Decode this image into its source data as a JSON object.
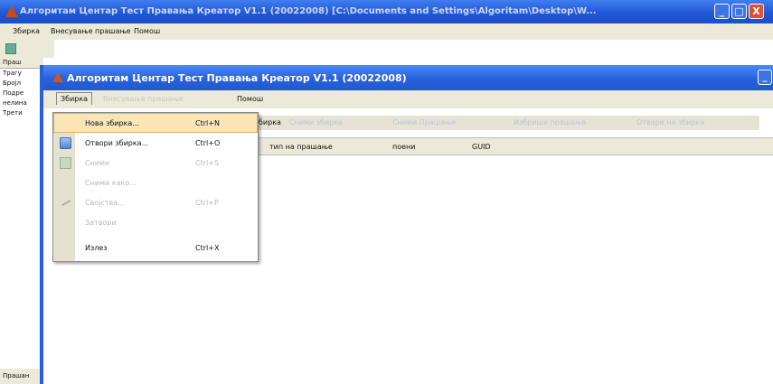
{
  "outer_window": {
    "title": "Алгоритам Центар Тест Правања Креатор V1.1 (20022008) [C:\\Documents and Settings\\Algoritam\\Desktop\\W...",
    "menu": [
      "Збирка",
      "Внесување прашање",
      "Помош"
    ],
    "left_panel": {
      "header": "Праш",
      "items": [
        "Трагу",
        "Бројл",
        "Подре",
        "нелина",
        "Трети"
      ]
    },
    "status_text": "Прашан",
    "controls": {
      "minimize": "_",
      "maximize": "□",
      "close": "X"
    }
  },
  "inner_window": {
    "title": "Алгоритам Центар Тест Правања Креатор V1.1 (20022008)",
    "menu": {
      "collection": "Збирка",
      "insert": "Внесување прашање",
      "help": "Помош"
    },
    "toolbar": {
      "partial_label": "бирка",
      "faded_items": [
        "Сними збирка",
        "Сними Прашање",
        "Избриши прашање",
        "Отвори на збирка"
      ]
    },
    "grid_columns": [
      "тип на прашање",
      "поени",
      "GUID"
    ],
    "minimize": "_"
  },
  "dropdown": {
    "items": [
      {
        "label": "Нова збирка...",
        "shortcut": "Ctrl+N",
        "enabled": true,
        "hover": true,
        "icon": "new-icon"
      },
      {
        "label": "Отвори збирка...",
        "shortcut": "Ctrl+O",
        "enabled": true,
        "hover": false,
        "icon": "open-icon"
      },
      {
        "label": "Сними",
        "shortcut": "Ctrl+S",
        "enabled": false,
        "hover": false,
        "icon": "save-icon"
      },
      {
        "label": "Сними како...",
        "shortcut": "",
        "enabled": false,
        "hover": false,
        "icon": ""
      },
      {
        "label": "Својства...",
        "shortcut": "Ctrl+P",
        "enabled": false,
        "hover": false,
        "icon": "properties-icon"
      },
      {
        "label": "Затвори",
        "shortcut": "",
        "enabled": false,
        "hover": false,
        "icon": ""
      },
      {
        "label": "Излез",
        "shortcut": "Ctrl+X",
        "enabled": true,
        "hover": false,
        "icon": ""
      }
    ]
  },
  "colors": {
    "title_bar": "#2960dc",
    "menu_bg": "#ece9d8",
    "hover_bg": "#f8e6b8",
    "close_button": "#e0502a"
  }
}
